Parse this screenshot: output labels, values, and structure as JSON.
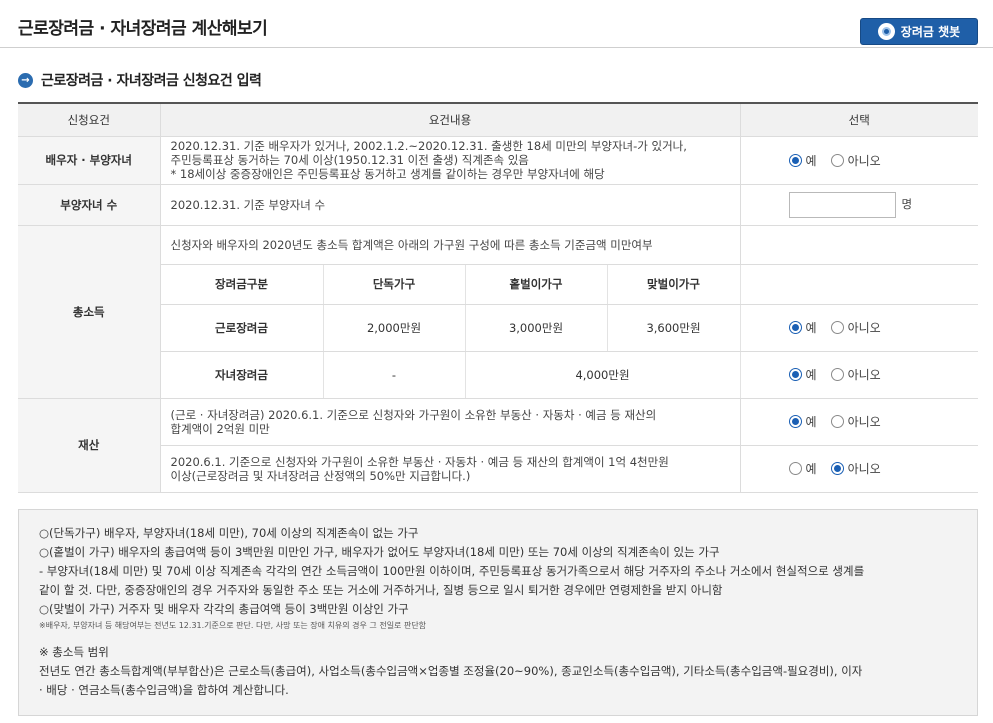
{
  "page": {
    "title": "근로장려금 · 자녀장려금 계산해보기",
    "chatbot_label": "장려금 챗봇"
  },
  "section": {
    "title": "근로장려금 · 자녀장려금 신청요건 입력"
  },
  "table": {
    "headers": [
      "신청요건",
      "요건내용",
      "선택"
    ],
    "spouse": {
      "label": "배우자 · 부양자녀",
      "lines": [
        "2020.12.31. 기준 배우자가 있거나, 2002.1.2.~2020.12.31. 출생한 18세 미만의 부양자녀-가 있거나,",
        "주민등록표상 동거하는 70세 이상(1950.12.31 이전 출생) 직계존속 있음",
        "* 18세이상 중증장애인은 주민등록표상 동거하고 생계를 같이하는 경우만 부양자녀에 해당"
      ]
    },
    "children_count": {
      "label": "부양자녀 수",
      "content": "2020.12.31. 기준 부양자녀 수",
      "value": "",
      "unit": "명"
    },
    "income": {
      "label": "총소득",
      "desc": "신청자와 배우자의 2020년도 총소득 합계액은 아래의 가구원 구성에 따른 총소득 기준금액 미만여부",
      "inner_headers": [
        "장려금구분",
        "단독가구",
        "홑벌이가구",
        "맞벌이가구"
      ],
      "earned": {
        "label": "근로장려금",
        "single": "2,000만원",
        "one_earner": "3,000만원",
        "dual": "3,600만원"
      },
      "child": {
        "label": "자녀장려금",
        "single": "-",
        "merged": "4,000만원"
      }
    },
    "property": {
      "label": "재산",
      "row1": [
        "(근로 · 자녀장려금) 2020.6.1. 기준으로 신청자와 가구원이 소유한 부동산 · 자동차 · 예금 등 재산의",
        "합계액이 2억원 미만"
      ],
      "row2": [
        "2020.6.1. 기준으로 신청자와 가구원이 소유한 부동산 · 자동차 · 예금 등 재산의 합계액이 1억 4천만원",
        "이상(근로장려금 및 자녀장려금 산정액의 50%만 지급합니다.)"
      ]
    },
    "radio_yes": "예",
    "radio_no": "아니오"
  },
  "notes": {
    "lines": [
      "○(단독가구) 배우자, 부양자녀(18세 미만), 70세 이상의 직계존속이 없는 가구",
      "○(홑벌이 가구) 배우자의 총급여액 등이 3백만원 미만인 가구, 배우자가 없어도 부양자녀(18세 미만) 또는 70세 이상의 직계존속이 있는 가구",
      "- 부양자녀(18세 미만) 및 70세 이상 직계존속 각각의 연간 소득금액이 100만원 이하이며, 주민등록표상 동거가족으로서 해당 거주자의 주소나 거소에서 현실적으로 생계를",
      "같이 할 것. 다만, 중증장애인의 경우 거주자와 동일한 주소 또는 거소에 거주하거나, 질병 등으로 일시 퇴거한 경우에만 연령제한을 받지 아니함",
      "○(맞벌이 가구) 거주자 및 배우자 각각의 총급여액 등이 3백만원 이상인 가구"
    ],
    "small": "※배우자, 부양자녀 등 해당여부는 전년도 12.31.기준으로 판단. 다만, 사망 또는 장애 치유의 경우 그 전일로 판단함",
    "range_title": "※ 총소득 범위",
    "range_lines": [
      "전년도 연간 총소득합계액(부부합산)은 근로소득(총급여), 사업소득(총수입금액×업종별 조정율(20~90%), 종교인소득(총수입금액), 기타소득(총수입금액-필요경비), 이자",
      "· 배당 · 연금소득(총수입금액)을 합하여 계산합니다."
    ]
  }
}
